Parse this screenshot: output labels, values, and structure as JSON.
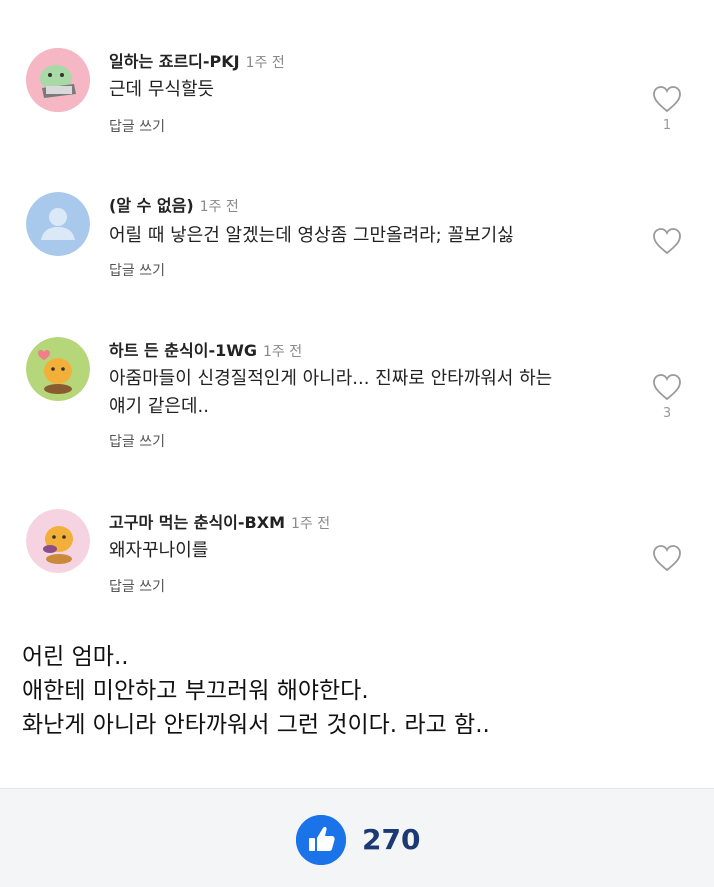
{
  "comments": [
    {
      "author": "일하는 죠르디-PKJ",
      "time": "1주 전",
      "body": [
        "근데 무식할듯"
      ],
      "reply_label": "답글 쓰기",
      "like_count": "1",
      "avatar": "jordy-working-avatar"
    },
    {
      "author": "(알 수 없음)",
      "time": "1주 전",
      "body": [
        "어릴 때 낳은건 알겠는데 영상좀 그만올려라; 꼴보기싫"
      ],
      "reply_label": "답글 쓰기",
      "like_count": "",
      "avatar": "default-user-avatar"
    },
    {
      "author": "하트 든 춘식이-1WG",
      "time": "1주 전",
      "body": [
        "아줌마들이 신경질적인게 아니라... 진짜로 안타까워서 하는",
        "얘기 같은데.."
      ],
      "reply_label": "답글 쓰기",
      "like_count": "3",
      "avatar": "choonsik-heart-avatar"
    },
    {
      "author": "고구마 먹는 춘식이-BXM",
      "time": "1주 전",
      "body": [
        "왜자꾸나이를"
      ],
      "reply_label": "답글 쓰기",
      "like_count": "",
      "avatar": "choonsik-sweetpotato-avatar"
    }
  ],
  "article": {
    "lines": [
      "어린 엄마..",
      "애한테 미안하고 부끄러워 해야한다.",
      "화난게 아니라 안타까워서 그런 것이다. 라고 함.."
    ]
  },
  "bottom_bar": {
    "like_total": "270",
    "icon": "thumbs-up-icon",
    "accent": "#1a73e8"
  }
}
